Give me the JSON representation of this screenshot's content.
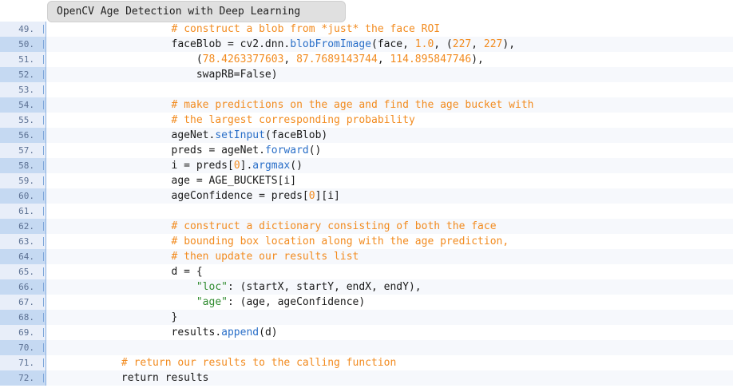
{
  "window": {
    "title": "OpenCV Age Detection with Deep Learning"
  },
  "lines": [
    {
      "n": "49.",
      "alt": false,
      "tokens": [
        {
          "t": "                    "
        },
        {
          "t": "# construct a blob from *just* the face ROI",
          "c": "comment"
        }
      ]
    },
    {
      "n": "50.",
      "alt": true,
      "tokens": [
        {
          "t": "                    faceBlob = cv2.dnn."
        },
        {
          "t": "blobFromImage",
          "c": "fn"
        },
        {
          "t": "(face, "
        },
        {
          "t": "1.0",
          "c": "num"
        },
        {
          "t": ", ("
        },
        {
          "t": "227",
          "c": "num"
        },
        {
          "t": ", "
        },
        {
          "t": "227",
          "c": "num"
        },
        {
          "t": "),"
        }
      ]
    },
    {
      "n": "51.",
      "alt": false,
      "tokens": [
        {
          "t": "                        ("
        },
        {
          "t": "78.4263377603",
          "c": "num"
        },
        {
          "t": ", "
        },
        {
          "t": "87.7689143744",
          "c": "num"
        },
        {
          "t": ", "
        },
        {
          "t": "114.895847746",
          "c": "num"
        },
        {
          "t": "),"
        }
      ]
    },
    {
      "n": "52.",
      "alt": true,
      "tokens": [
        {
          "t": "                        swapRB=False)"
        }
      ]
    },
    {
      "n": "53.",
      "alt": false,
      "tokens": [
        {
          "t": ""
        }
      ]
    },
    {
      "n": "54.",
      "alt": true,
      "tokens": [
        {
          "t": "                    "
        },
        {
          "t": "# make predictions on the age and find the age bucket with",
          "c": "comment"
        }
      ]
    },
    {
      "n": "55.",
      "alt": false,
      "tokens": [
        {
          "t": "                    "
        },
        {
          "t": "# the largest corresponding probability",
          "c": "comment"
        }
      ]
    },
    {
      "n": "56.",
      "alt": true,
      "tokens": [
        {
          "t": "                    ageNet."
        },
        {
          "t": "setInput",
          "c": "fn"
        },
        {
          "t": "(faceBlob)"
        }
      ]
    },
    {
      "n": "57.",
      "alt": false,
      "tokens": [
        {
          "t": "                    preds = ageNet."
        },
        {
          "t": "forward",
          "c": "fn"
        },
        {
          "t": "()"
        }
      ]
    },
    {
      "n": "58.",
      "alt": true,
      "tokens": [
        {
          "t": "                    i = preds["
        },
        {
          "t": "0",
          "c": "num"
        },
        {
          "t": "]."
        },
        {
          "t": "argmax",
          "c": "fn"
        },
        {
          "t": "()"
        }
      ]
    },
    {
      "n": "59.",
      "alt": false,
      "tokens": [
        {
          "t": "                    age = AGE_BUCKETS[i]"
        }
      ]
    },
    {
      "n": "60.",
      "alt": true,
      "tokens": [
        {
          "t": "                    ageConfidence = preds["
        },
        {
          "t": "0",
          "c": "num"
        },
        {
          "t": "][i]"
        }
      ]
    },
    {
      "n": "61.",
      "alt": false,
      "tokens": [
        {
          "t": ""
        }
      ]
    },
    {
      "n": "62.",
      "alt": true,
      "tokens": [
        {
          "t": "                    "
        },
        {
          "t": "# construct a dictionary consisting of both the face",
          "c": "comment"
        }
      ]
    },
    {
      "n": "63.",
      "alt": false,
      "tokens": [
        {
          "t": "                    "
        },
        {
          "t": "# bounding box location along with the age prediction,",
          "c": "comment"
        }
      ]
    },
    {
      "n": "64.",
      "alt": true,
      "tokens": [
        {
          "t": "                    "
        },
        {
          "t": "# then update our results list",
          "c": "comment"
        }
      ]
    },
    {
      "n": "65.",
      "alt": false,
      "tokens": [
        {
          "t": "                    d = {"
        }
      ]
    },
    {
      "n": "66.",
      "alt": true,
      "tokens": [
        {
          "t": "                        "
        },
        {
          "t": "\"loc\"",
          "c": "str"
        },
        {
          "t": ": (startX, startY, endX, endY),"
        }
      ]
    },
    {
      "n": "67.",
      "alt": false,
      "tokens": [
        {
          "t": "                        "
        },
        {
          "t": "\"age\"",
          "c": "str"
        },
        {
          "t": ": (age, ageConfidence)"
        }
      ]
    },
    {
      "n": "68.",
      "alt": true,
      "tokens": [
        {
          "t": "                    }"
        }
      ]
    },
    {
      "n": "69.",
      "alt": false,
      "tokens": [
        {
          "t": "                    results."
        },
        {
          "t": "append",
          "c": "fn"
        },
        {
          "t": "(d)"
        }
      ]
    },
    {
      "n": "70.",
      "alt": true,
      "tokens": [
        {
          "t": ""
        }
      ]
    },
    {
      "n": "71.",
      "alt": false,
      "tokens": [
        {
          "t": "            "
        },
        {
          "t": "# return our results to the calling function",
          "c": "comment"
        }
      ]
    },
    {
      "n": "72.",
      "alt": true,
      "tokens": [
        {
          "t": "            return results"
        }
      ]
    }
  ]
}
